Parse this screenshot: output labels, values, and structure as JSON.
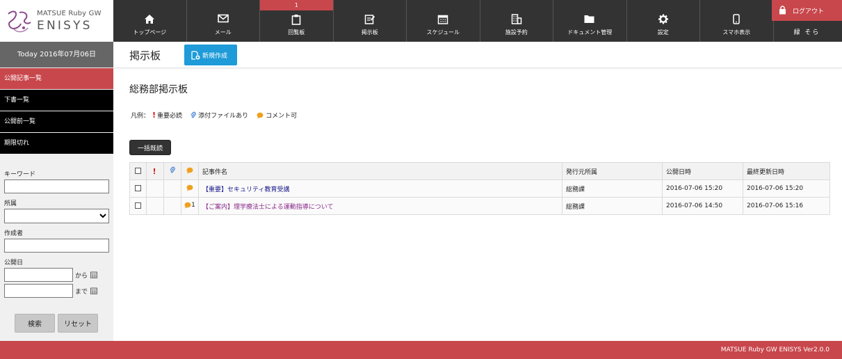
{
  "brand": {
    "top_line": "MATSUE Ruby GW",
    "name": "ENISYS"
  },
  "nav": [
    {
      "label": "トップページ",
      "icon": "home-icon",
      "badge": ""
    },
    {
      "label": "メール",
      "icon": "mail-icon",
      "badge": ""
    },
    {
      "label": "回覧板",
      "icon": "clipboard-icon",
      "badge": "1"
    },
    {
      "label": "掲示板",
      "icon": "bulletin-board-icon",
      "badge": ""
    },
    {
      "label": "スケジュール",
      "icon": "calendar-icon",
      "badge": ""
    },
    {
      "label": "施設予約",
      "icon": "building-icon",
      "badge": ""
    },
    {
      "label": "ドキュメント管理",
      "icon": "folder-icon",
      "badge": ""
    },
    {
      "label": "設定",
      "icon": "gear-icon",
      "badge": ""
    },
    {
      "label": "スマホ表示",
      "icon": "smartphone-icon",
      "badge": ""
    }
  ],
  "header": {
    "logout_label": "ログアウト",
    "user_name": "緑 そら"
  },
  "sidebar": {
    "today": "Today 2016年07月06日",
    "items": [
      {
        "label": "公開記事一覧",
        "active": true
      },
      {
        "label": "下書一覧",
        "active": false
      },
      {
        "label": "公開前一覧",
        "active": false
      },
      {
        "label": "期限切れ",
        "active": false
      }
    ],
    "search": {
      "keyword_label": "キーワード",
      "keyword_value": "",
      "dept_label": "所属",
      "dept_value": "",
      "author_label": "作成者",
      "author_value": "",
      "date_label": "公開日",
      "date_from_value": "",
      "date_from_suffix": "から",
      "date_to_value": "",
      "date_to_suffix": "まで",
      "search_button": "検索",
      "reset_button": "リセット"
    }
  },
  "page": {
    "title": "掲示板",
    "new_button": "新規作成",
    "board_title": "総務部掲示板",
    "legend": {
      "prefix": "凡例：",
      "important": "重要必読",
      "attachment": "添付ファイルあり",
      "comment": "コメント可"
    },
    "bulk_read_button": "一括既読"
  },
  "table": {
    "headers": {
      "title": "記事件名",
      "dept": "発行元所属",
      "published": "公開日時",
      "updated": "最終更新日時"
    },
    "rows": [
      {
        "title": "【重要】セキュリティ教育受講",
        "comment_count": "",
        "dept": "総務課",
        "published": "2016-07-06 15:20",
        "updated": "2016-07-06 15:20"
      },
      {
        "title": "【ご案内】理学療法士による運動指導について",
        "comment_count": "1",
        "dept": "総務課",
        "published": "2016-07-06 14:50",
        "updated": "2016-07-06 15:16"
      }
    ]
  },
  "footer": {
    "text": "MATSUE Ruby GW ENISYS Ver2.0.0"
  },
  "colors": {
    "accent_red": "#c8474c",
    "nav_dark": "#333333",
    "primary_blue": "#1e9bd8",
    "comment_orange": "#f0a020"
  }
}
